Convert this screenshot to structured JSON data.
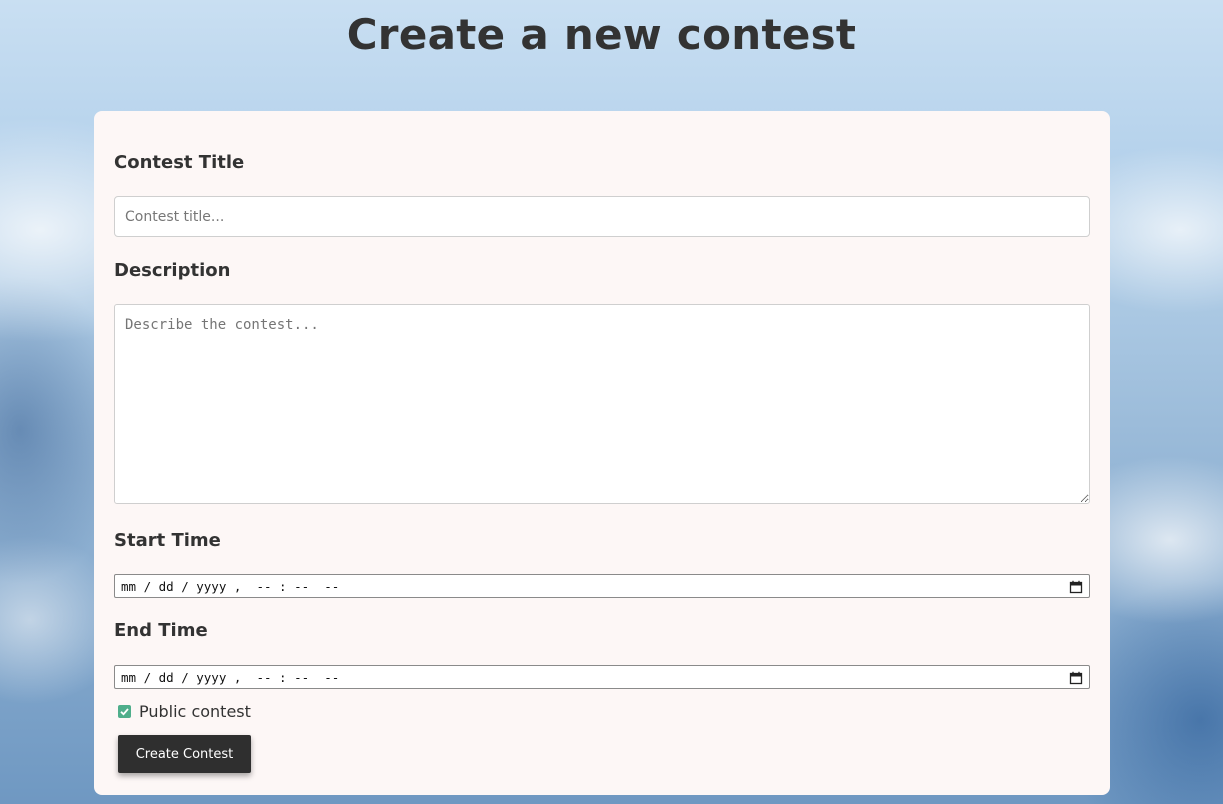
{
  "page": {
    "title": "Create a new contest"
  },
  "form": {
    "title_label": "Contest Title",
    "title_placeholder": "Contest title...",
    "title_value": "",
    "description_label": "Description",
    "description_placeholder": "Describe the contest...",
    "description_value": "",
    "start_label": "Start Time",
    "start_display": "mm / dd / yyyy ,  -- : --  --",
    "end_label": "End Time",
    "end_display": "mm / dd / yyyy ,  -- : --  --",
    "public_checked": true,
    "public_label": "Public contest",
    "submit_label": "Create Contest"
  },
  "icons": {
    "datetime_picker": "calendar-icon",
    "checkbox": "checkmark-icon"
  },
  "colors": {
    "card_background": "#fdf7f6",
    "checkbox_accent": "#4fae8b",
    "button_background": "#2f2f2f",
    "text": "#333333"
  }
}
